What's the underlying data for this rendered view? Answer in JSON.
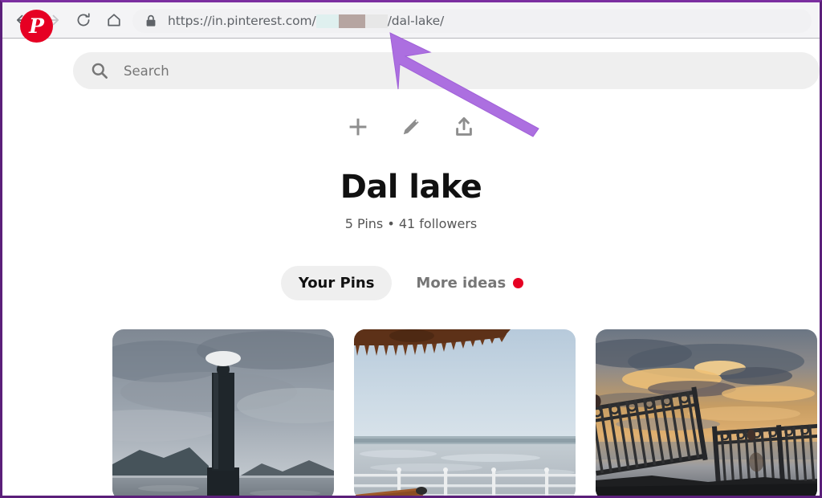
{
  "browser": {
    "nav": {
      "back_label": "Back",
      "forward_label": "Forward",
      "reload_label": "Reload",
      "home_label": "Home"
    },
    "omnibox": {
      "security_icon": "lock-icon",
      "url_prefix": "https://in.pinterest.com/",
      "url_suffix": "/dal-lake/",
      "redacted_label": "",
      "redact_colors": [
        "#dff0ef",
        "#b6a5a1",
        "#e7e7e7"
      ]
    }
  },
  "pinterest": {
    "logo_glyph": "P",
    "logo_color": "#e60023",
    "search": {
      "placeholder": "Search",
      "icon": "search-icon"
    },
    "board_actions": [
      {
        "name": "add-pin-button",
        "icon": "plus-icon",
        "label": "Add"
      },
      {
        "name": "edit-board-button",
        "icon": "pencil-icon",
        "label": "Edit"
      },
      {
        "name": "share-board-button",
        "icon": "share-upload-icon",
        "label": "Share"
      }
    ],
    "board": {
      "title": "Dal lake",
      "meta": "5 Pins • 41 followers",
      "pin_count": "5 Pins",
      "follower_count": "41 followers"
    },
    "tabs": [
      {
        "label": "Your Pins",
        "active": true,
        "badge": false
      },
      {
        "label": "More ideas",
        "active": false,
        "badge": true,
        "badge_color": "#e60023"
      }
    ],
    "pins": [
      {
        "name": "pin-lamp-post-lake",
        "alt": "Lamp post silhouette against overcast sky over lake with mountains"
      },
      {
        "name": "pin-houseboat-lake-view",
        "alt": "Lake view from houseboat with zigzag wooden awning and white railing"
      },
      {
        "name": "pin-sunset-iron-fence",
        "alt": "Sunset sky with silhouetted iron fence and perched birds"
      }
    ]
  },
  "annotation": {
    "arrow_color": "#ac6fe0",
    "arrow_target": "omnibox-url"
  }
}
